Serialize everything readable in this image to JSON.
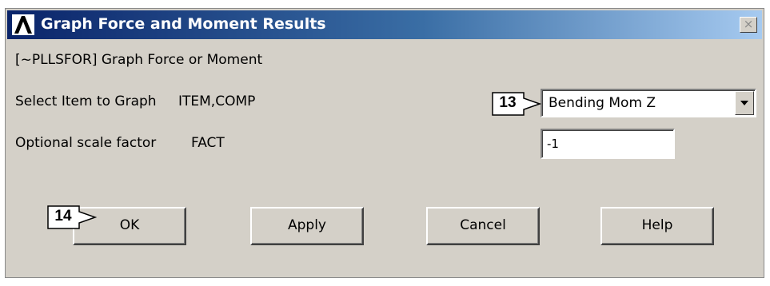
{
  "window": {
    "title": "Graph Force and Moment Results",
    "close_glyph": "×"
  },
  "form": {
    "heading": "[~PLLSFOR] Graph Force or Moment",
    "item_label": "Select Item to Graph",
    "item_param": "ITEM,COMP",
    "item_value": "Bending Mom Z",
    "scale_label": "Optional scale factor",
    "scale_param": "FACT",
    "scale_value": "-1"
  },
  "buttons": {
    "ok": "OK",
    "apply": "Apply",
    "cancel": "Cancel",
    "help": "Help"
  },
  "callouts": {
    "select": "13",
    "ok": "14"
  },
  "colors": {
    "titlebar_start": "#0a246a",
    "titlebar_end": "#a6caf0",
    "dialog_bg": "#d4d0c8"
  }
}
